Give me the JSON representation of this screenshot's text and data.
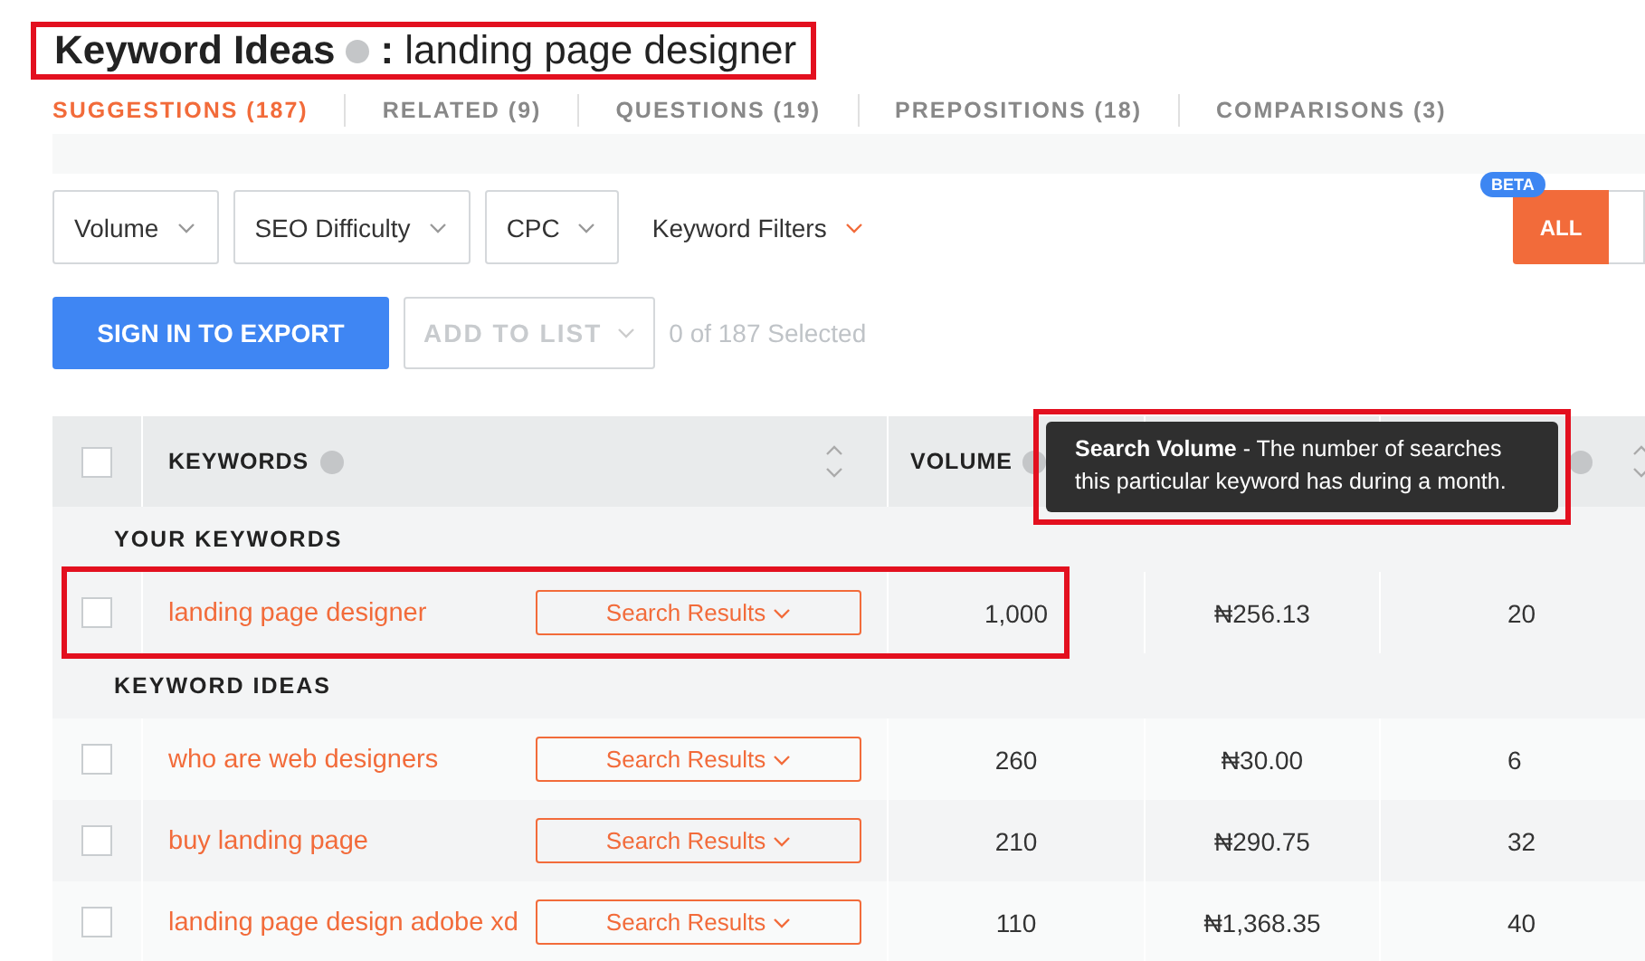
{
  "title": {
    "label": "Keyword Ideas",
    "separator": ":",
    "query": "landing page designer",
    "highlighted": true
  },
  "tabs": [
    {
      "label": "SUGGESTIONS (187)",
      "selected": true
    },
    {
      "label": "RELATED (9)",
      "selected": false
    },
    {
      "label": "QUESTIONS (19)",
      "selected": false
    },
    {
      "label": "PREPOSITIONS (18)",
      "selected": false
    },
    {
      "label": "COMPARISONS (3)",
      "selected": false
    }
  ],
  "filters": [
    {
      "label": "Volume"
    },
    {
      "label": "SEO Difficulty"
    },
    {
      "label": "CPC"
    }
  ],
  "keyword_filters": "Keyword Filters",
  "beta_badge": "BETA",
  "all_button": "ALL",
  "export_button": "SIGN IN TO EXPORT",
  "add_to_list": {
    "label": "ADD TO LIST",
    "disabled": true
  },
  "selection_count": "0 of 187 Selected",
  "table": {
    "select_all": {
      "checked": false
    },
    "columns": [
      {
        "label": "KEYWORDS"
      },
      {
        "label": "VOLUME"
      }
    ],
    "tooltip": {
      "text": "**Search Volume** - The number of searches this particular keyword has during a month.",
      "highlighted": true
    },
    "groups": [
      {
        "label": "YOUR KEYWORDS",
        "rows": [
          {
            "keyword": "landing page designer",
            "action": "Search Results",
            "volume": "1,000",
            "cpc": "₦256.13",
            "column_5": "20",
            "checked": false,
            "highlighted": true
          }
        ]
      },
      {
        "label": "KEYWORD IDEAS",
        "rows": [
          {
            "keyword": "who are web designers",
            "action": "Search Results",
            "volume": "260",
            "cpc": "₦30.00",
            "column_5": "6",
            "checked": false,
            "highlighted": false
          },
          {
            "keyword": "buy landing page",
            "action": "Search Results",
            "volume": "210",
            "cpc": "₦290.75",
            "column_5": "32",
            "checked": false,
            "highlighted": false
          },
          {
            "keyword": "landing page design adobe xd",
            "action": "Search Results",
            "volume": "110",
            "cpc": "₦1,368.35",
            "column_5": "40",
            "checked": false,
            "highlighted": false
          }
        ]
      }
    ]
  }
}
